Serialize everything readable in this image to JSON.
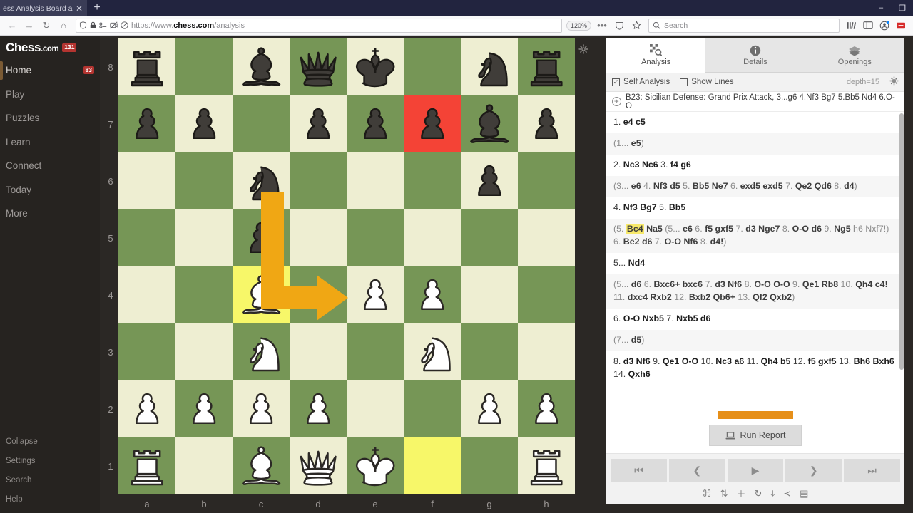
{
  "browser": {
    "tab_title": "ess Analysis Board and PGN",
    "tab_close": "✕",
    "new_tab": "+",
    "window_minimize": "–",
    "window_restore": "❐",
    "back": "←",
    "forward": "→",
    "reload": "↻",
    "home": "⌂",
    "url_protocol": "https://www.",
    "url_domain": "chess.com",
    "url_path": "/analysis",
    "zoom_level": "120%",
    "menu_dots": "•••",
    "search_placeholder": "Search",
    "shield_icon": "Ⓥ",
    "lock_icon": "ὑ2"
  },
  "sidebar": {
    "logo": "Chess",
    "logo_suffix": ".com",
    "logo_badge": "131",
    "items": [
      {
        "label": "Home",
        "badge": "83",
        "active": true
      },
      {
        "label": "Play",
        "badge": "",
        "active": false
      },
      {
        "label": "Puzzles",
        "badge": "",
        "active": false
      },
      {
        "label": "Learn",
        "badge": "",
        "active": false
      },
      {
        "label": "Connect",
        "badge": "",
        "active": false
      },
      {
        "label": "Today",
        "badge": "",
        "active": false
      },
      {
        "label": "More",
        "badge": "",
        "active": false
      }
    ],
    "bottom_items": [
      {
        "label": "Collapse"
      },
      {
        "label": "Settings"
      },
      {
        "label": "Search"
      },
      {
        "label": "Help"
      }
    ]
  },
  "board": {
    "rank_labels": [
      "8",
      "7",
      "6",
      "5",
      "4",
      "3",
      "2",
      "1"
    ],
    "file_labels": [
      "a",
      "b",
      "c",
      "d",
      "e",
      "f",
      "g",
      "h"
    ],
    "light_color": "#eeeed2",
    "dark_color": "#769656",
    "highlight_yellow": "#f7f769",
    "highlight_red": "#f44336",
    "arrow_color": "#f0a714",
    "position": [
      [
        "br",
        "",
        "bb",
        "bq",
        "bk",
        "",
        "bn",
        "br"
      ],
      [
        "bp",
        "bp",
        "",
        "bp",
        "bp",
        "bp",
        "bb",
        "bp"
      ],
      [
        "",
        "",
        "bn",
        "",
        "",
        "",
        "bp",
        ""
      ],
      [
        "",
        "",
        "bp",
        "",
        "",
        "",
        "",
        ""
      ],
      [
        "",
        "",
        "wb",
        "",
        "wp",
        "wp",
        "",
        ""
      ],
      [
        "",
        "",
        "wn",
        "",
        "",
        "wn",
        "",
        ""
      ],
      [
        "wp",
        "wp",
        "wp",
        "wp",
        "",
        "",
        "wp",
        "wp"
      ],
      [
        "wr",
        "",
        "wb",
        "wq",
        "wk",
        "",
        "",
        "wr"
      ]
    ],
    "highlights": [
      {
        "square": "f7",
        "type": "red"
      },
      {
        "square": "c4",
        "type": "yellow"
      },
      {
        "square": "f1",
        "type": "yellow"
      }
    ],
    "arrow": {
      "from": "c4",
      "to": "d4_via_c6",
      "description": "knight-style arrow from c4 up and right"
    },
    "gear_icon": "⚙"
  },
  "panel": {
    "tabs": [
      {
        "label": "Analysis",
        "icon": "analysis-board-icon",
        "active": true
      },
      {
        "label": "Details",
        "icon": "info-icon",
        "active": false
      },
      {
        "label": "Openings",
        "icon": "books-icon",
        "active": false
      }
    ],
    "options": {
      "self_analysis_label": "Self Analysis",
      "self_analysis_checked": true,
      "show_lines_label": "Show Lines",
      "show_lines_checked": false,
      "depth_label": "depth=15",
      "gear_icon": "⚙"
    },
    "opening": "B23: Sicilian Defense: Grand Prix Attack, 3...g6 4.Nf3 Bg7 5.Bb5 Nd4 6.O-O",
    "moves": [
      {
        "variation": false,
        "parts": [
          {
            "t": "1. ",
            "b": false
          },
          {
            "t": "e4 c5",
            "b": true
          }
        ]
      },
      {
        "variation": true,
        "parts": [
          {
            "t": "(1... ",
            "b": false
          },
          {
            "t": "e5",
            "b": true
          },
          {
            "t": ")",
            "b": false
          }
        ]
      },
      {
        "variation": false,
        "parts": [
          {
            "t": "2. ",
            "b": false
          },
          {
            "t": "Nc3 Nc6",
            "b": true
          },
          {
            "t": " 3. ",
            "b": false
          },
          {
            "t": "f4 g6",
            "b": true
          }
        ]
      },
      {
        "variation": true,
        "parts": [
          {
            "t": "(3... ",
            "b": false
          },
          {
            "t": "e6",
            "b": true
          },
          {
            "t": " 4. ",
            "b": false
          },
          {
            "t": "Nf3 d5",
            "b": true
          },
          {
            "t": " 5. ",
            "b": false
          },
          {
            "t": "Bb5 Ne7",
            "b": true
          },
          {
            "t": " 6. ",
            "b": false
          },
          {
            "t": "exd5 exd5",
            "b": true
          },
          {
            "t": " 7. ",
            "b": false
          },
          {
            "t": "Qe2 Qd6",
            "b": true
          },
          {
            "t": " 8. ",
            "b": false
          },
          {
            "t": "d4",
            "b": true
          },
          {
            "t": ")",
            "b": false
          }
        ]
      },
      {
        "variation": false,
        "parts": [
          {
            "t": "4. ",
            "b": false
          },
          {
            "t": "Nf3 Bg7",
            "b": true
          },
          {
            "t": " 5. ",
            "b": false
          },
          {
            "t": "Bb5",
            "b": true
          }
        ]
      },
      {
        "variation": true,
        "highlight": "Bc4",
        "parts": [
          {
            "t": "(5. ",
            "b": false
          },
          {
            "t": "Bc4",
            "b": true,
            "hl": true
          },
          {
            "t": " Na5",
            "b": true
          },
          {
            "t": " (5... ",
            "b": false
          },
          {
            "t": "e6",
            "b": true
          },
          {
            "t": " 6. ",
            "b": false
          },
          {
            "t": "f5 gxf5",
            "b": true
          },
          {
            "t": " 7. ",
            "b": false
          },
          {
            "t": "d3 Nge7",
            "b": true
          },
          {
            "t": " 8. ",
            "b": false
          },
          {
            "t": "O-O d6",
            "b": true
          },
          {
            "t": " 9. ",
            "b": false
          },
          {
            "t": "Ng5",
            "b": true
          },
          {
            "t": " h6 Nxf7!)",
            "b": false
          },
          {
            "t": " 6. ",
            "b": false
          },
          {
            "t": "Be2 d6",
            "b": true
          },
          {
            "t": " 7. ",
            "b": false
          },
          {
            "t": "O-O Nf6",
            "b": true
          },
          {
            "t": " 8. ",
            "b": false
          },
          {
            "t": "d4!",
            "b": true
          },
          {
            "t": ")",
            "b": false
          }
        ]
      },
      {
        "variation": false,
        "parts": [
          {
            "t": "5... ",
            "b": false
          },
          {
            "t": "Nd4",
            "b": true
          }
        ]
      },
      {
        "variation": true,
        "parts": [
          {
            "t": "(5... ",
            "b": false
          },
          {
            "t": "d6",
            "b": true
          },
          {
            "t": " 6. ",
            "b": false
          },
          {
            "t": "Bxc6+ bxc6",
            "b": true
          },
          {
            "t": " 7. ",
            "b": false
          },
          {
            "t": "d3 Nf6",
            "b": true
          },
          {
            "t": " 8. ",
            "b": false
          },
          {
            "t": "O-O O-O",
            "b": true
          },
          {
            "t": " 9. ",
            "b": false
          },
          {
            "t": "Qe1 Rb8",
            "b": true
          },
          {
            "t": " 10. ",
            "b": false
          },
          {
            "t": "Qh4 c4!",
            "b": true
          },
          {
            "t": " 11. ",
            "b": false
          },
          {
            "t": "dxc4 Rxb2",
            "b": true
          },
          {
            "t": " 12. ",
            "b": false
          },
          {
            "t": "Bxb2 Qb6+",
            "b": true
          },
          {
            "t": " 13. ",
            "b": false
          },
          {
            "t": "Qf2 Qxb2",
            "b": true
          },
          {
            "t": ")",
            "b": false
          }
        ]
      },
      {
        "variation": false,
        "parts": [
          {
            "t": "6. ",
            "b": false
          },
          {
            "t": "O-O Nxb5",
            "b": true
          },
          {
            "t": " 7. ",
            "b": false
          },
          {
            "t": "Nxb5 d6",
            "b": true
          }
        ]
      },
      {
        "variation": true,
        "parts": [
          {
            "t": "(7... ",
            "b": false
          },
          {
            "t": "d5",
            "b": true
          },
          {
            "t": ")",
            "b": false
          }
        ]
      },
      {
        "variation": false,
        "parts": [
          {
            "t": "8. ",
            "b": false
          },
          {
            "t": "d3 Nf6",
            "b": true
          },
          {
            "t": " 9. ",
            "b": false
          },
          {
            "t": "Qe1 O-O",
            "b": true
          },
          {
            "t": " 10. ",
            "b": false
          },
          {
            "t": "Nc3 a6",
            "b": true
          },
          {
            "t": " 11. ",
            "b": false
          },
          {
            "t": "Qh4 b5",
            "b": true
          },
          {
            "t": " 12. ",
            "b": false
          },
          {
            "t": "f5 gxf5",
            "b": true
          },
          {
            "t": " 13. ",
            "b": false
          },
          {
            "t": "Bh6 Bxh6",
            "b": true
          },
          {
            "t": " 14. ",
            "b": false
          },
          {
            "t": "Qxh6",
            "b": true
          }
        ]
      }
    ],
    "eval_bar_color": "#e68f19",
    "run_report_label": "Run Report",
    "nav_buttons": [
      {
        "name": "first-move-button",
        "glyph": "⏮"
      },
      {
        "name": "previous-move-button",
        "glyph": "❮"
      },
      {
        "name": "play-button",
        "glyph": "▶"
      },
      {
        "name": "next-move-button",
        "glyph": "❯"
      },
      {
        "name": "last-move-button",
        "glyph": "⏭"
      }
    ],
    "tools": [
      {
        "name": "engine-icon",
        "glyph": "⌘"
      },
      {
        "name": "flip-board-icon",
        "glyph": "⇅"
      },
      {
        "name": "add-icon",
        "glyph": "＋"
      },
      {
        "name": "reset-icon",
        "glyph": "↻"
      },
      {
        "name": "download-icon",
        "glyph": "⤓"
      },
      {
        "name": "share-icon",
        "glyph": "≺"
      },
      {
        "name": "vs-computer-icon",
        "glyph": "▤"
      }
    ]
  }
}
